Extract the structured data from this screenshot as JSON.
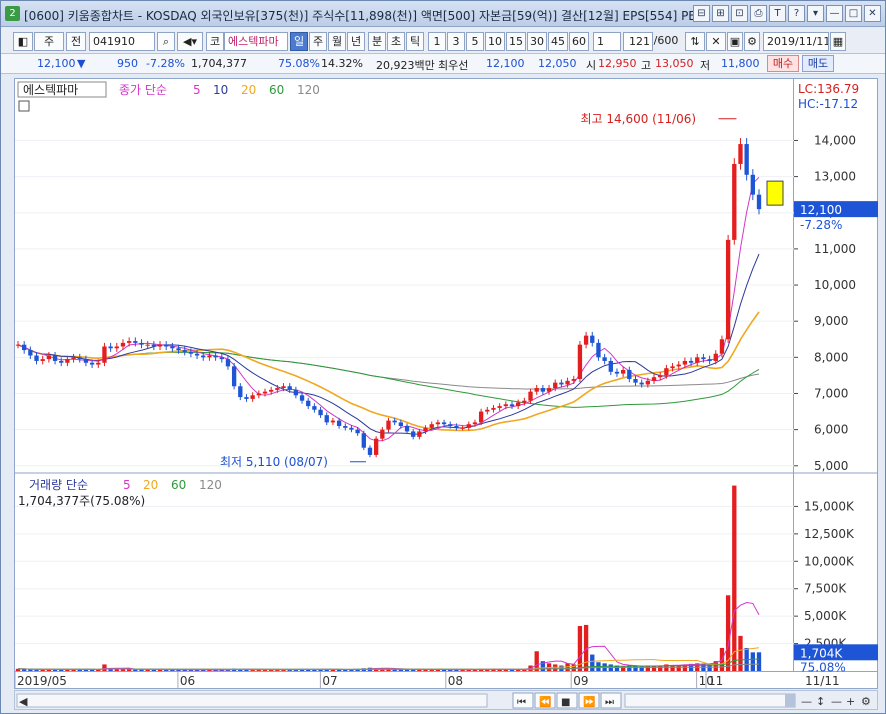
{
  "window": {
    "badge": "2",
    "title": "[0600] 키움종합차트 - KOSDAQ 외국인보유[375(천)] 주식수[11,898(천)] 액면[500] 자본금[59(억)] 결산[12월] EPS[554] PER[",
    "buttons": [
      "⊟",
      "⊞",
      "⊡",
      "⎙",
      "T",
      "?",
      "▾",
      "—",
      "□",
      "✕"
    ]
  },
  "toolbar": {
    "period_select": "주",
    "prev_label": "전",
    "code": "041910",
    "mode": "코",
    "stock_name": "에스텍파마",
    "periods": [
      "일",
      "주",
      "월",
      "년",
      "분",
      "초",
      "틱"
    ],
    "selected_period": "일",
    "intervals": [
      "1",
      "3",
      "5",
      "10",
      "15",
      "30",
      "45",
      "60"
    ],
    "unit": "1",
    "count": "121",
    "count_max": "/600",
    "date": "2019/11/11"
  },
  "quote": {
    "price": "12,100",
    "arrow": "▼",
    "change": "950",
    "change_pct": "-7.28%",
    "volume": "1,704,377",
    "vol_ratio": "75.08%",
    "turnover": "14.32%",
    "amount": "20,923백만",
    "best_label": "최우선",
    "best_ask": "12,100",
    "best_bid": "12,050",
    "open_label": "시",
    "open": "12,950",
    "high_label": "고",
    "high": "13,050",
    "low_label": "저",
    "low": "11,800",
    "buy_label": "매수",
    "sell_label": "매도"
  },
  "price_panel": {
    "name_label": "에스텍파마",
    "legend_prefix": "종가 단순",
    "ma": [
      "5",
      "10",
      "20",
      "60",
      "120"
    ],
    "lc": "LC:136.79",
    "hc": "HC:-17.12",
    "last_price": "12,100",
    "last_pct": "-7.28%",
    "high_annotation": "최고 14,600 (11/06)",
    "low_annotation": "최저 5,110 (08/07)"
  },
  "volume_panel": {
    "legend_prefix": "거래량 단순",
    "ma": [
      "5",
      "20",
      "60",
      "120"
    ],
    "current": "1,704,377주(75.08%)",
    "last_vol": "1,704K",
    "last_pct": "75.08%"
  },
  "colors": {
    "up": "#e41e1e",
    "down": "#1e55d6",
    "ma5": "#d238c8",
    "ma10": "#2c3a9c",
    "ma20": "#f0a820",
    "ma60": "#2e9a3a",
    "ma120": "#8a8a8a"
  },
  "bottom": {
    "last_date": "11/11"
  },
  "chart_data": {
    "type": "candlestick",
    "price_ticks": [
      "14,000",
      "13,000",
      "12,000",
      "11,000",
      "10,000",
      "9,000",
      "8,000",
      "7,000",
      "6,000",
      "5,000"
    ],
    "price_tick_values": [
      14000,
      13000,
      12000,
      11000,
      10000,
      9000,
      8000,
      7000,
      6000,
      5000
    ],
    "volume_ticks": [
      "15,000K",
      "12,500K",
      "10,000K",
      "7,500K",
      "5,000K",
      "2,500K"
    ],
    "volume_tick_values": [
      15000,
      12500,
      10000,
      7500,
      5000,
      2500
    ],
    "x_labels": [
      "2019/05",
      "06",
      "07",
      "08",
      "09",
      "10",
      "11"
    ],
    "price_range": [
      4800,
      15700
    ],
    "volume_range": [
      0,
      17500
    ],
    "closes": [
      8350,
      8200,
      8050,
      7900,
      7950,
      8050,
      7900,
      7850,
      7950,
      8000,
      7950,
      7850,
      7800,
      7850,
      8300,
      8250,
      8300,
      8400,
      8450,
      8400,
      8350,
      8350,
      8300,
      8350,
      8300,
      8250,
      8200,
      8150,
      8100,
      8050,
      8000,
      8050,
      8000,
      7950,
      7750,
      7200,
      6900,
      6850,
      6950,
      7000,
      7050,
      7100,
      7150,
      7200,
      7100,
      6950,
      6800,
      6650,
      6550,
      6400,
      6200,
      6250,
      6100,
      6050,
      6000,
      5900,
      5500,
      5300,
      5750,
      6000,
      6250,
      6200,
      6100,
      5950,
      5800,
      5950,
      6050,
      6150,
      6200,
      6150,
      6100,
      6050,
      6050,
      6150,
      6200,
      6500,
      6550,
      6600,
      6650,
      6700,
      6650,
      6750,
      6800,
      7050,
      7150,
      7050,
      7150,
      7300,
      7250,
      7350,
      7400,
      8350,
      8600,
      8400,
      8000,
      7900,
      7600,
      7550,
      7650,
      7400,
      7300,
      7250,
      7350,
      7450,
      7500,
      7700,
      7750,
      7800,
      7900,
      7850,
      8000,
      7950,
      7900,
      8100,
      8500,
      11250,
      13350,
      13900,
      13050,
      12500,
      12100
    ],
    "volumes": [
      200,
      180,
      150,
      140,
      150,
      160,
      140,
      130,
      150,
      170,
      140,
      130,
      120,
      130,
      600,
      200,
      180,
      160,
      170,
      150,
      140,
      130,
      120,
      140,
      130,
      120,
      110,
      120,
      110,
      100,
      100,
      110,
      100,
      100,
      150,
      220,
      180,
      150,
      140,
      130,
      120,
      130,
      140,
      150,
      130,
      140,
      170,
      150,
      140,
      130,
      160,
      140,
      130,
      120,
      150,
      180,
      250,
      300,
      260,
      220,
      200,
      180,
      160,
      150,
      140,
      130,
      120,
      150,
      140,
      130,
      120,
      110,
      120,
      150,
      160,
      200,
      180,
      170,
      160,
      150,
      140,
      160,
      180,
      500,
      1800,
      900,
      700,
      600,
      500,
      700,
      600,
      4100,
      4200,
      1500,
      800,
      700,
      600,
      500,
      400,
      500,
      450,
      400,
      420,
      460,
      500,
      600,
      550,
      520,
      600,
      650,
      700,
      680,
      650,
      900,
      2100,
      6900,
      16900,
      3200,
      2100,
      1700,
      1704
    ]
  }
}
